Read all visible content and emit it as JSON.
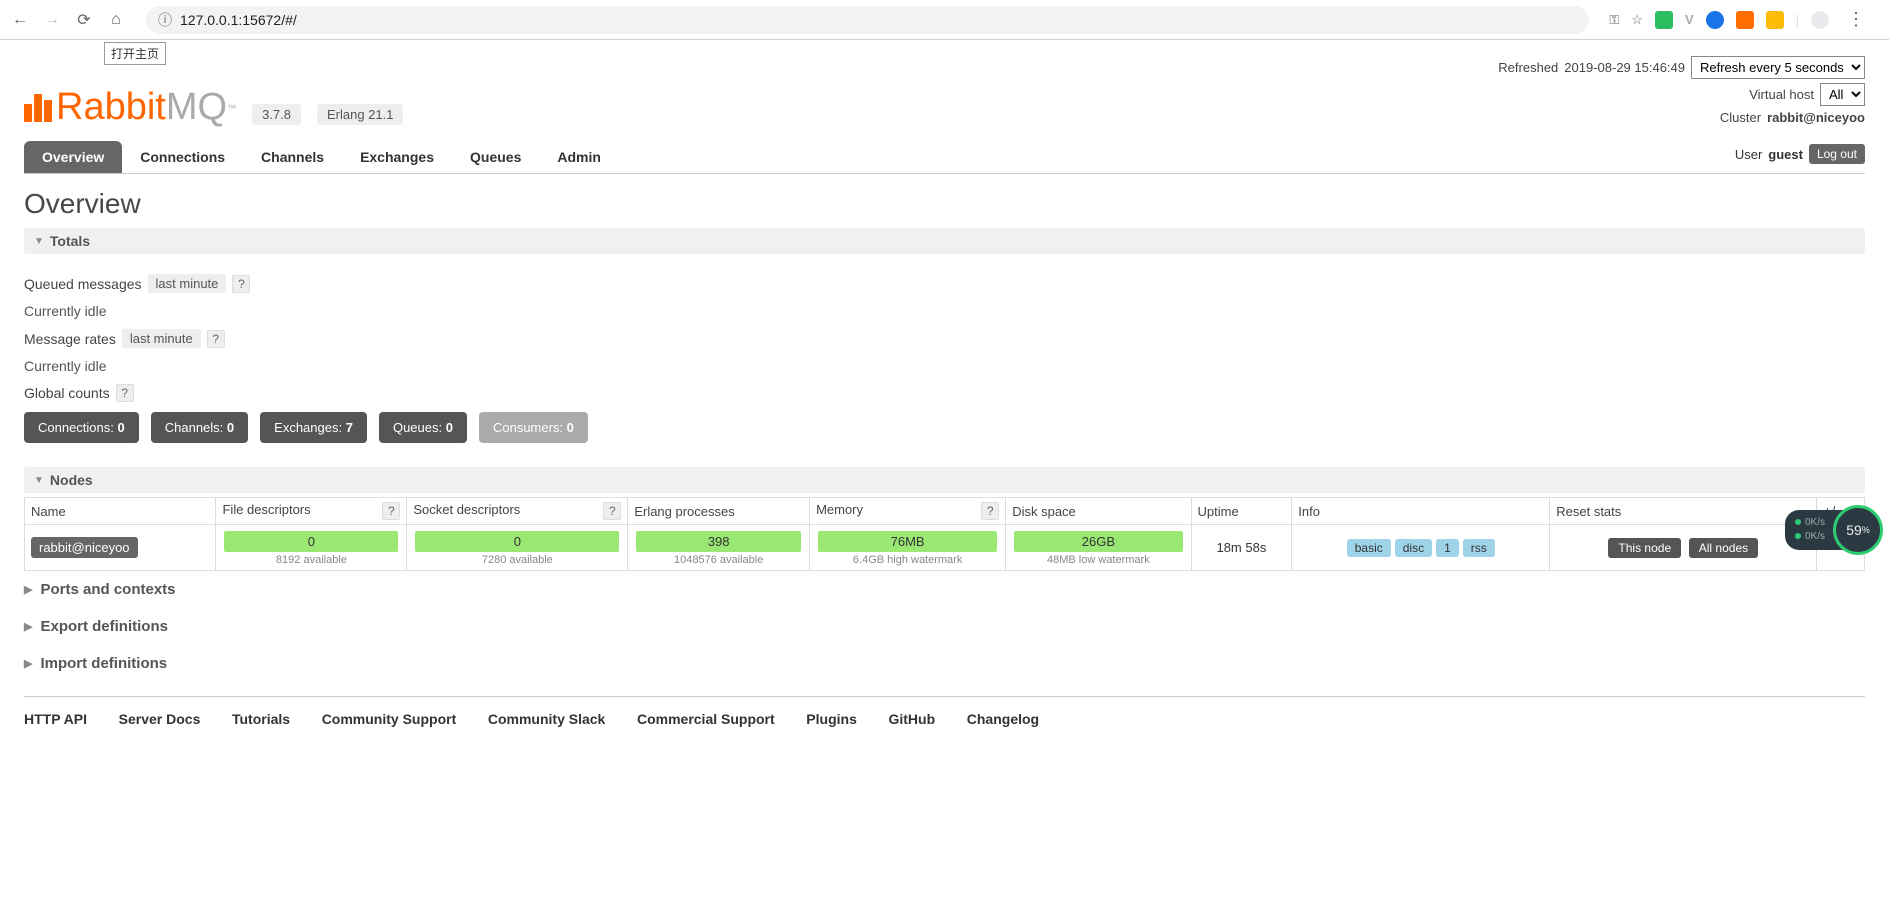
{
  "browser": {
    "url": "127.0.0.1:15672/#/",
    "tooltip": "打开主页"
  },
  "header": {
    "logo_rabbit": "Rabbit",
    "logo_mq": "MQ",
    "version": "3.7.8",
    "erlang": "Erlang 21.1",
    "refreshed_label": "Refreshed",
    "refreshed_time": "2019-08-29 15:46:49",
    "refresh_option": "Refresh every 5 seconds",
    "vhost_label": "Virtual host",
    "vhost_value": "All",
    "cluster_label": "Cluster",
    "cluster_value": "rabbit@niceyoo",
    "user_label": "User",
    "user_value": "guest",
    "logout": "Log out"
  },
  "tabs": {
    "overview": "Overview",
    "connections": "Connections",
    "channels": "Channels",
    "exchanges": "Exchanges",
    "queues": "Queues",
    "admin": "Admin"
  },
  "page_title": "Overview",
  "totals": {
    "heading": "Totals",
    "queued_label": "Queued messages",
    "queued_range": "last minute",
    "queued_status": "Currently idle",
    "rates_label": "Message rates",
    "rates_range": "last minute",
    "rates_status": "Currently idle",
    "global_label": "Global counts",
    "counts": {
      "connections_label": "Connections:",
      "connections_val": "0",
      "channels_label": "Channels:",
      "channels_val": "0",
      "exchanges_label": "Exchanges:",
      "exchanges_val": "7",
      "queues_label": "Queues:",
      "queues_val": "0",
      "consumers_label": "Consumers:",
      "consumers_val": "0"
    }
  },
  "nodes": {
    "heading": "Nodes",
    "cols": {
      "name": "Name",
      "fd": "File descriptors",
      "sd": "Socket descriptors",
      "ep": "Erlang processes",
      "mem": "Memory",
      "disk": "Disk space",
      "uptime": "Uptime",
      "info": "Info",
      "reset": "Reset stats",
      "pm": "+/-"
    },
    "row": {
      "name": "rabbit@niceyoo",
      "fd_val": "0",
      "fd_sub": "8192 available",
      "sd_val": "0",
      "sd_sub": "7280 available",
      "ep_val": "398",
      "ep_sub": "1048576 available",
      "mem_val": "76MB",
      "mem_sub": "6.4GB high watermark",
      "disk_val": "26GB",
      "disk_sub": "48MB low watermark",
      "uptime": "18m 58s",
      "info_basic": "basic",
      "info_disc": "disc",
      "info_1": "1",
      "info_rss": "rss",
      "reset_this": "This node",
      "reset_all": "All nodes"
    }
  },
  "collapsed": {
    "ports": "Ports and contexts",
    "export": "Export definitions",
    "import": "Import definitions"
  },
  "footer": {
    "http_api": "HTTP API",
    "server_docs": "Server Docs",
    "tutorials": "Tutorials",
    "community_support": "Community Support",
    "community_slack": "Community Slack",
    "commercial": "Commercial Support",
    "plugins": "Plugins",
    "github": "GitHub",
    "changelog": "Changelog"
  },
  "perf": {
    "up": "0K/s",
    "down": "0K/s",
    "percent": "59",
    "percent_sym": "%"
  }
}
